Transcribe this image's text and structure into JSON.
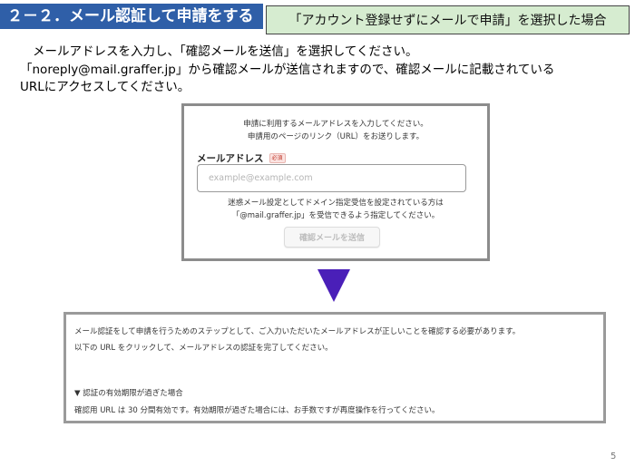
{
  "slide": {
    "title": "２－２．メール認証して申請をする",
    "tag": "「アカウント登録せずにメールで申請」を選択した場合",
    "page_number": "5"
  },
  "intro": {
    "line1": "メールアドレスを入力し、「確認メールを送信」を選択してください。",
    "line2": "「noreply@mail.graffer.jp」から確認メールが送信されますので、確認メールに記載されている",
    "line3": "URLにアクセスしてください。"
  },
  "form": {
    "desc_line1": "申請に利用するメールアドレスを入力してください。",
    "desc_line2": "申請用のページのリンク（URL）をお送りします。",
    "email_label": "メールアドレス",
    "required_badge": "必須",
    "email_value": "",
    "email_placeholder": "example@example.com",
    "spam_line1": "迷惑メール設定としてドメイン指定受信を設定されている方は",
    "spam_line2": "「@mail.graffer.jp」を受信できるよう指定してください。",
    "send_button_label": "確認メールを送信"
  },
  "email_body": {
    "line1": "メール認証をして申請を行うためのステップとして、ご入力いただいたメールアドレスが正しいことを確認する必要があります。",
    "line2": "以下の URL をクリックして、メールアドレスの認証を完了してください。",
    "line3": "▼ 認証の有効期限が過ぎた場合",
    "line4": "確認用 URL は 30 分間有効です。有効期限が過ぎた場合には、お手数ですが再度操作を行ってください。"
  },
  "colors": {
    "title_bar": "#2f5fa8",
    "tag_background": "#d6ecd0",
    "arrow": "#4a1fb8",
    "required_badge": "#c0392b"
  },
  "icons": {
    "arrow": "down-triangle-arrow-icon"
  }
}
